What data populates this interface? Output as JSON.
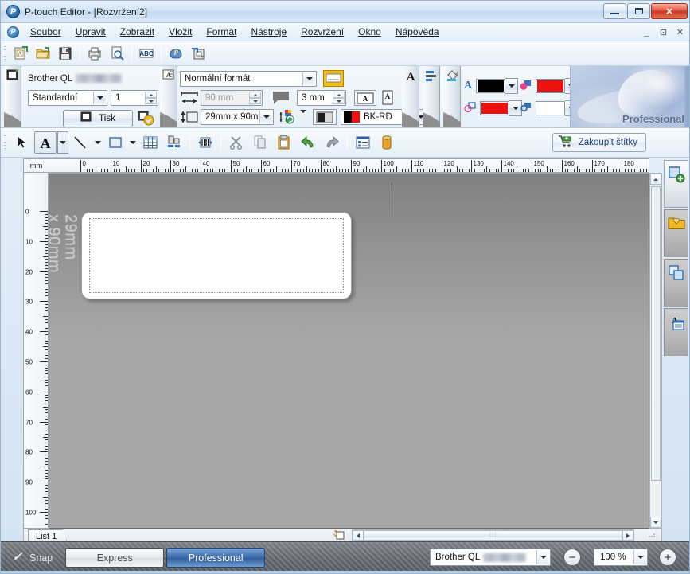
{
  "window": {
    "title": "P-touch Editor - [Rozvržení2]",
    "app_icon": "ptouch-logo-icon",
    "minimize": "minimize-icon",
    "maximize": "maximize-icon",
    "close": "close-icon"
  },
  "menu": {
    "doc_icon": "document-icon",
    "items": [
      {
        "label": "Soubor"
      },
      {
        "label": "Upravit"
      },
      {
        "label": "Zobrazit"
      },
      {
        "label": "Vložit"
      },
      {
        "label": "Formát"
      },
      {
        "label": "Nástroje"
      },
      {
        "label": "Rozvržení"
      },
      {
        "label": "Okno"
      },
      {
        "label": "Nápověda"
      }
    ],
    "mdi": {
      "restore": "⊡",
      "minimize": "_",
      "close": "✕"
    }
  },
  "toolbar_standard": {
    "buttons": [
      {
        "name": "new-layout-icon",
        "tip": "Nový"
      },
      {
        "name": "open-folder-icon",
        "tip": "Otevřít"
      },
      {
        "name": "save-icon",
        "tip": "Uložit"
      },
      {
        "name": "print-icon",
        "tip": "Tisk"
      },
      {
        "name": "print-preview-icon",
        "tip": "Náhled"
      },
      {
        "name": "spellcheck-abc-icon",
        "tip": "ABC"
      },
      {
        "name": "ptouch-library-icon",
        "tip": "P-touch Library"
      },
      {
        "name": "export-icon",
        "tip": "Export"
      }
    ]
  },
  "property_panel": {
    "print_tab_icon": "printer-tab-icon",
    "printer_name_prefix": "Brother QL",
    "printer_name_blurred": true,
    "quality_select": "Standardní",
    "copies": "1",
    "print_button": "Tisk",
    "print_button_icon": "printer-icon",
    "print_options_icon": "print-options-icon",
    "layout_tab_icon": "layout-tab-icon",
    "format_select": "Normální formát",
    "format_preview_icon": "label-preview-icon",
    "length_icon": "width-arrow-icon",
    "length_value": "90 mm",
    "length_disabled": true,
    "margin_icon": "margin-icon",
    "margin_value": "3 mm",
    "text_orientation_icon": "text-horizontal-icon",
    "text_rotate_icon": "text-rotate-icon",
    "height_icon": "height-arrow-icon",
    "tape_select": "29mm x 90m",
    "color_mode_icon": "color-mode-icon",
    "contrast_icon": "contrast-icon",
    "tape_color_select": "BK-RD",
    "tape_color_swatch_left": "#000000",
    "tape_color_swatch_right": "#ee1111",
    "tabs_right": [
      {
        "name": "text-tab-icon",
        "glyph": "A"
      },
      {
        "name": "layout-align-tab-icon",
        "glyph": "align"
      },
      {
        "name": "fill-paint-tab-icon",
        "glyph": "paint"
      }
    ],
    "colors": [
      {
        "name": "text-color",
        "icon": "text-color-icon",
        "value": "#000000"
      },
      {
        "name": "fill-color",
        "icon": "fill-color-icon",
        "value": "#ee1111"
      },
      {
        "name": "line-color",
        "icon": "line-color-icon",
        "value": "#ee1111"
      },
      {
        "name": "background-color",
        "icon": "background-color-icon",
        "value": "#ffffff"
      }
    ],
    "watermark": "Professional"
  },
  "toolbar_draw": {
    "tools": [
      {
        "name": "select-arrow-tool",
        "glyph": "arrow"
      },
      {
        "name": "text-tool",
        "glyph": "A",
        "has_dropdown": true,
        "active": true
      },
      {
        "name": "line-tool",
        "glyph": "line",
        "has_dropdown": true
      },
      {
        "name": "rectangle-tool",
        "glyph": "rect",
        "has_dropdown": true
      },
      {
        "name": "table-tool",
        "glyph": "table"
      },
      {
        "name": "align-tool",
        "glyph": "align"
      },
      {
        "name": "barcode-tool",
        "glyph": "barcode"
      },
      {
        "name": "cut-tool",
        "glyph": "scissors"
      },
      {
        "name": "copy-tool",
        "glyph": "copy"
      },
      {
        "name": "paste-tool",
        "glyph": "clipboard"
      },
      {
        "name": "undo-tool",
        "glyph": "undo"
      },
      {
        "name": "redo-tool",
        "glyph": "redo"
      },
      {
        "name": "database-tool",
        "glyph": "db-form"
      },
      {
        "name": "numbering-tool",
        "glyph": "drum"
      }
    ],
    "buy_labels": {
      "label": "Zakoupit štítky",
      "icon": "shopping-cart-icon"
    }
  },
  "rulers": {
    "unit": "mm",
    "h_ticks": [
      0,
      10,
      20,
      30,
      40,
      50,
      60,
      70,
      80,
      90,
      100,
      110,
      120,
      130,
      140,
      150,
      160,
      170,
      180
    ],
    "v_ticks": [
      0,
      10,
      20,
      30,
      40,
      50,
      60,
      70,
      80,
      90
    ]
  },
  "canvas": {
    "label_size_caption": "29mm\nx 90mm",
    "label_width_mm": 90,
    "label_height_mm": 29
  },
  "side_tabs": [
    {
      "name": "new-label-tab",
      "icon": "new-label-icon",
      "active": true
    },
    {
      "name": "favorites-tab",
      "icon": "favorites-folder-icon",
      "active": false
    },
    {
      "name": "layouts-tab",
      "icon": "layouts-stack-icon",
      "active": false
    },
    {
      "name": "text-list-tab",
      "icon": "text-list-icon",
      "active": false
    }
  ],
  "sheet_tabs": [
    {
      "label": "List 1",
      "active": true
    }
  ],
  "scrollbars": {
    "h_grip": "⦙⦙⦙",
    "left_arrow": "◄",
    "right_arrow": "►",
    "up_arrow": "▲",
    "down_arrow": "▼"
  },
  "bottom_bar": {
    "snap": {
      "label": "Snap",
      "icon": "snap-icon"
    },
    "express": {
      "label": "Express",
      "active": false
    },
    "professional": {
      "label": "Professional",
      "active": true
    },
    "printer_select": "Brother QL",
    "printer_select_blurred": true,
    "zoom_out_icon": "zoom-out-icon",
    "zoom_value": "100 %",
    "zoom_in_icon": "zoom-in-icon"
  }
}
